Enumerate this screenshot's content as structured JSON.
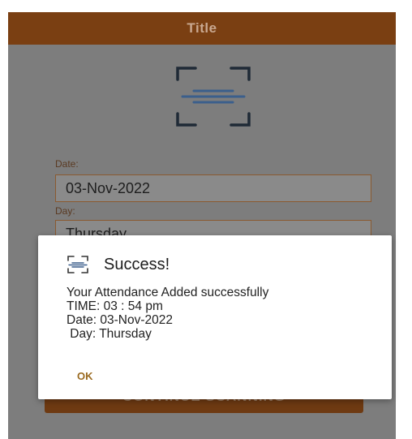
{
  "app_bar": {
    "title": "Title"
  },
  "form": {
    "date_label": "Date:",
    "date_value": "03-Nov-2022",
    "day_label": "Day:",
    "day_value": "Thursday"
  },
  "continue_button": {
    "label": "CONTINUE SCANNING"
  },
  "dialog": {
    "title": "Success!",
    "lines": [
      "Your Attendance Added successfully",
      "TIME: 03 : 54 pm",
      "Date: 03-Nov-2022",
      " Day: Thursday"
    ],
    "ok_label": "OK"
  },
  "icons": {
    "scan": "scan-icon"
  },
  "colors": {
    "app_bar": "#7a3f12",
    "accent": "#9a6a20",
    "overlay": "#7d7d7d"
  }
}
